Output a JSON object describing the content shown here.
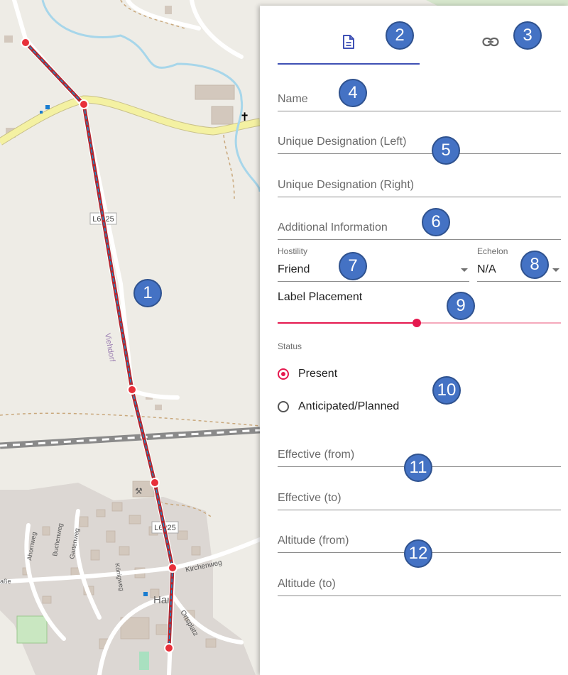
{
  "map": {
    "road_labels": [
      "L6025",
      "L6025",
      "Viehdorf",
      "Kirchenweg",
      "Ortsplatz",
      "Ahornweg",
      "Buchenweg",
      "Gartenweg",
      "Königweg",
      "aße"
    ],
    "place_label": "Hart",
    "colors": {
      "route_outer": "#b3262f",
      "route_inner": "#1a8ec8",
      "waypoint": "#e8303a",
      "main_road": "#f4f1a2"
    }
  },
  "panel": {
    "tabs": [
      {
        "icon": "document-icon",
        "active": true
      },
      {
        "icon": "link-icon",
        "active": false
      }
    ],
    "fields": {
      "name": "Name",
      "unique_left": "Unique Designation (Left)",
      "unique_right": "Unique Designation (Right)",
      "additional": "Additional Information"
    },
    "hostility": {
      "label": "Hostility",
      "value": "Friend"
    },
    "echelon": {
      "label": "Echelon",
      "value": "N/A"
    },
    "label_placement": {
      "label": "Label Placement",
      "value": 0.49
    },
    "status": {
      "label": "Status",
      "options": [
        {
          "label": "Present",
          "selected": true
        },
        {
          "label": "Anticipated/Planned",
          "selected": false
        }
      ]
    },
    "effective_from": "Effective (from)",
    "effective_to": "Effective (to)",
    "altitude_from": "Altitude (from)",
    "altitude_to": "Altitude (to)",
    "accent_color": "#e5194f",
    "tab_accent_color": "#3f51b5"
  },
  "annotations": [
    "1",
    "2",
    "3",
    "4",
    "5",
    "6",
    "7",
    "8",
    "9",
    "10",
    "11",
    "12"
  ]
}
